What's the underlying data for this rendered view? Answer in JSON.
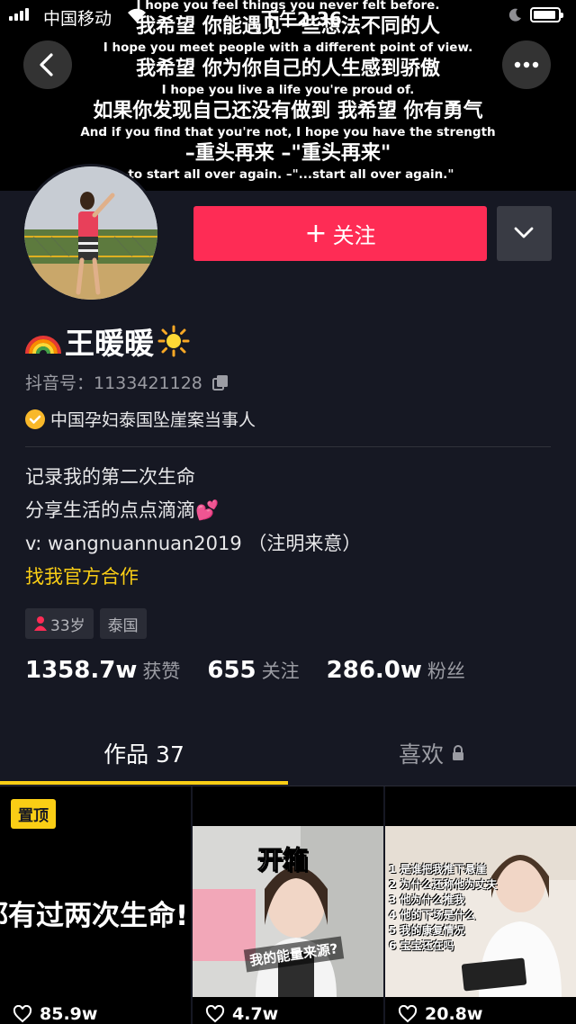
{
  "status_bar": {
    "carrier": "中国移动",
    "time": "下午2:36"
  },
  "lyrics": [
    {
      "zh": "",
      "en": "I hope you feel things you never felt before."
    },
    {
      "zh": "我希望 你能遇见一些想法不同的人",
      "en": "I hope you meet people with a different point of view."
    },
    {
      "zh": "我希望 你为你自己的人生感到骄傲",
      "en": "I hope you live a life you're proud of."
    },
    {
      "zh": "如果你发现自己还没有做到 我希望 你有勇气",
      "en": "And if you find that you're not, I hope you have the strength"
    },
    {
      "zh": "–重头再来 –\"重头再来\"",
      "en": "–to start all over again. –\"...start all over again.\""
    }
  ],
  "profile": {
    "name": "王暖暖",
    "name_prefix_emoji": "rainbow-emoji",
    "name_suffix_emoji": "sun-emoji",
    "douyin_id": "抖音号：1133421128",
    "verification": "中国孕妇泰国坠崖案当事人",
    "bio": [
      "记录我的第二次生命",
      "分享生活的点点滴滴💕",
      "v: wangnuannuan2019 （注明来意）"
    ],
    "cooperation_link": "找我官方合作",
    "tags": [
      "33岁",
      "泰国"
    ],
    "stats": {
      "likes_value": "1358.7w",
      "likes_label": "获赞",
      "following_value": "655",
      "following_label": "关注",
      "followers_value": "286.0w",
      "followers_label": "粉丝"
    }
  },
  "actions": {
    "follow_label": "关注"
  },
  "tabs": {
    "works_label": "作品 37",
    "likes_label": "喜欢"
  },
  "videos": [
    {
      "pin_label": "置顶",
      "text": "都有过两次生命!",
      "likes": "85.9w"
    },
    {
      "title": "开箱",
      "caption": "我的能量来源?",
      "likes": "4.7w"
    },
    {
      "list": [
        "1 是谁把我推下悬崖",
        "2 为什么还称他为丈夫",
        "3 他为什么推我",
        "4 他的下场是什么",
        "5 我的康复情况",
        "6 宝宝还在吗"
      ],
      "likes": "20.8w"
    }
  ],
  "colors": {
    "background": "#161823",
    "accent": "#fe2c55",
    "highlight": "#face15",
    "verify": "#f8b82a"
  }
}
